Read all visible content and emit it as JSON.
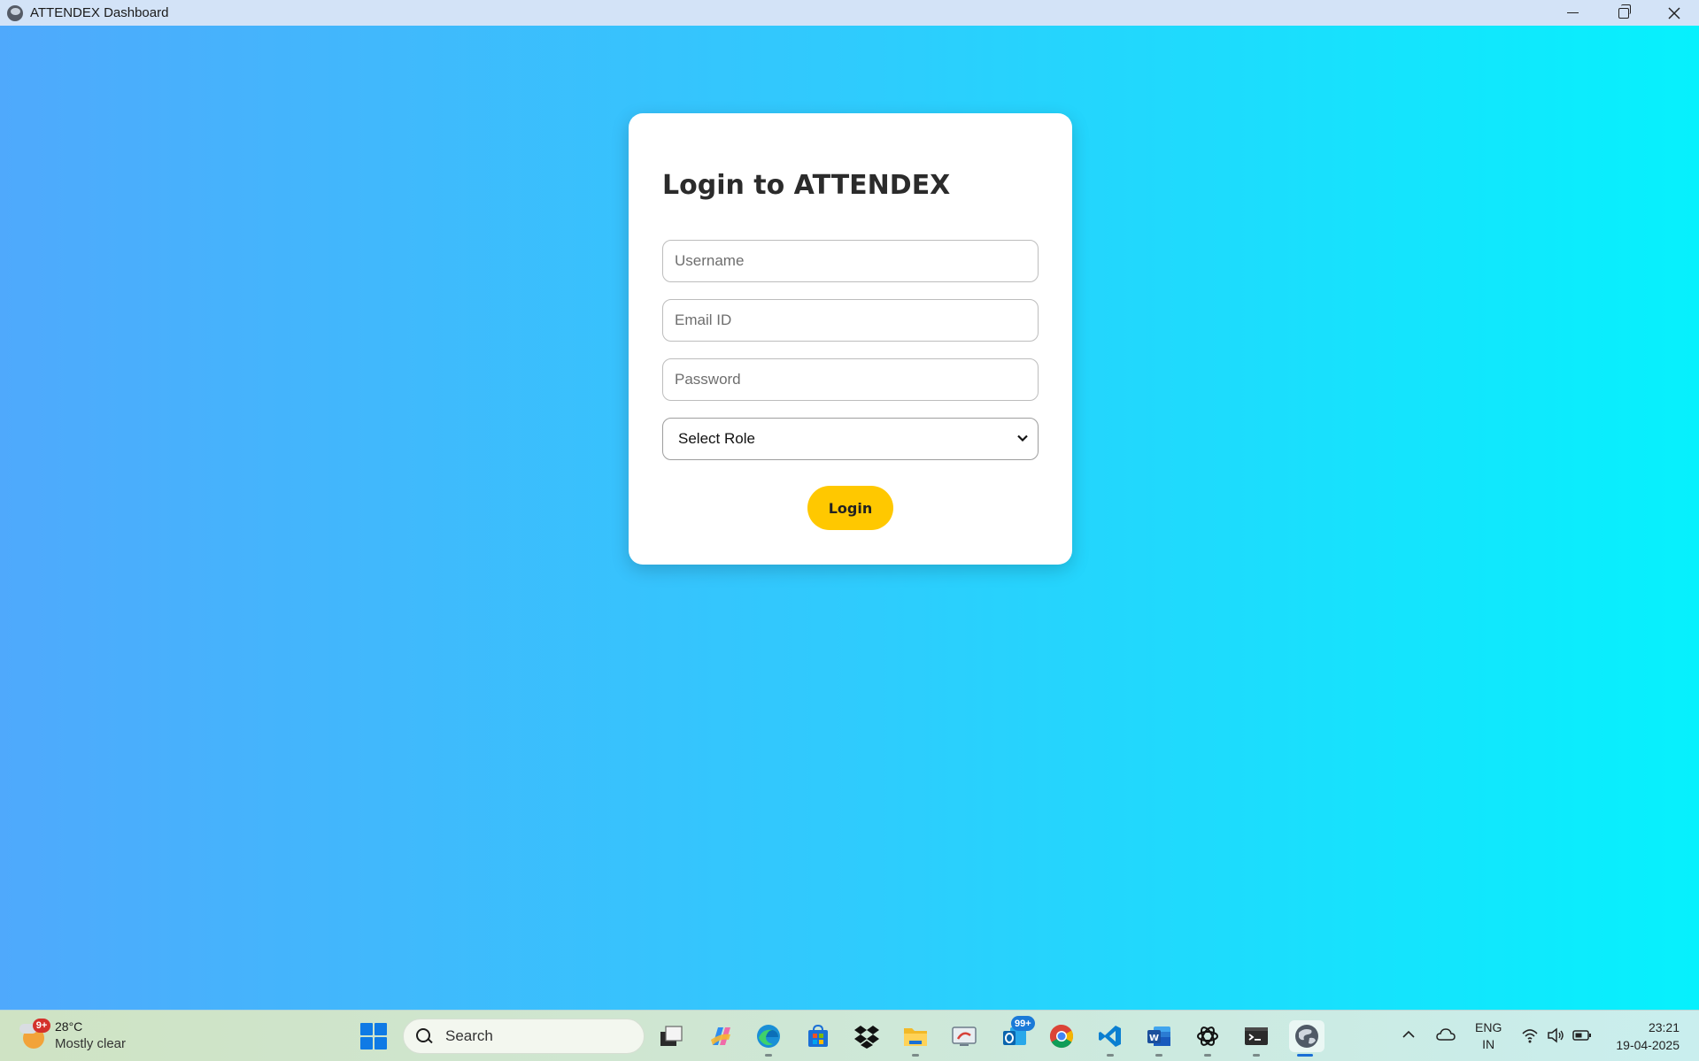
{
  "window": {
    "title": "ATTENDEX Dashboard"
  },
  "login": {
    "heading": "Login to ATTENDEX",
    "username_placeholder": "Username",
    "email_placeholder": "Email ID",
    "password_placeholder": "Password",
    "role_selected": "Select Role",
    "submit_label": "Login"
  },
  "taskbar": {
    "weather": {
      "temp": "28°C",
      "description": "Mostly clear",
      "badge": "9+"
    },
    "search_label": "Search",
    "apps": [
      {
        "name": "task-view"
      },
      {
        "name": "copilot"
      },
      {
        "name": "edge"
      },
      {
        "name": "microsoft-store"
      },
      {
        "name": "dropbox"
      },
      {
        "name": "file-explorer"
      },
      {
        "name": "remote-desktop"
      },
      {
        "name": "outlook",
        "badge": "99+"
      },
      {
        "name": "chrome"
      },
      {
        "name": "vs-code"
      },
      {
        "name": "word"
      },
      {
        "name": "chatgpt"
      },
      {
        "name": "terminal"
      },
      {
        "name": "attendex"
      }
    ],
    "language": {
      "line1": "ENG",
      "line2": "IN"
    },
    "clock": {
      "time": "23:21",
      "date": "19-04-2025"
    }
  },
  "colors": {
    "gradient_start": "#4fa9fc",
    "gradient_end": "#06f1fd",
    "login_button": "#ffc800",
    "card": "#ffffff"
  }
}
